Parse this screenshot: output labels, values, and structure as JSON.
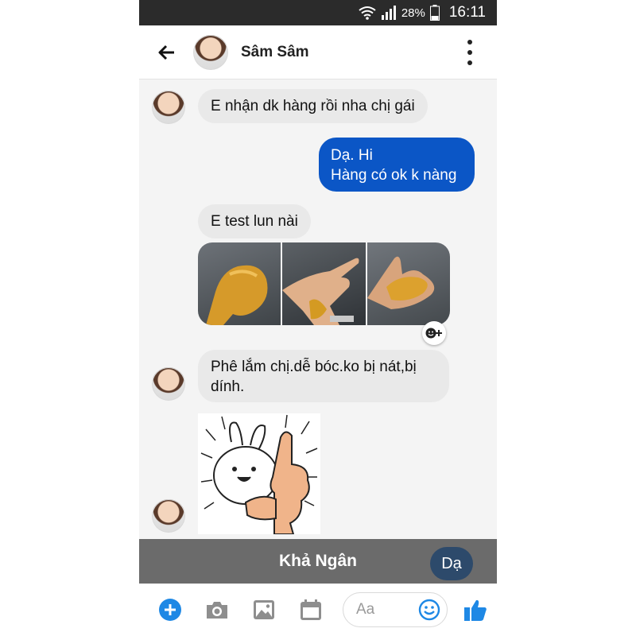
{
  "status_bar": {
    "battery": "28%",
    "time": "16:11",
    "icons": [
      "wifi-icon",
      "signal-icon",
      "battery-icon"
    ]
  },
  "header": {
    "contact_name": "Sâm Sâm",
    "icons": [
      "back-arrow-icon",
      "more-vertical-icon"
    ]
  },
  "messages": [
    {
      "direction": "incoming",
      "text": "E nhận dk hàng rồi nha chị gái"
    },
    {
      "direction": "outgoing",
      "lines": [
        "Dạ. Hi",
        "Hàng có ok k nàng"
      ]
    },
    {
      "direction": "incoming",
      "text": "E test lun nài"
    },
    {
      "direction": "incoming",
      "type": "photos",
      "count": 3
    },
    {
      "direction": "incoming",
      "lines": [
        "Phê lắm chị.dễ bóc.ko bị nát,bị",
        "dính."
      ]
    },
    {
      "direction": "incoming",
      "type": "sticker",
      "sticker": "rabbit-thumbs-up"
    }
  ],
  "banner": {
    "name": "Khả Ngân",
    "quick_reply": "Dạ"
  },
  "composer": {
    "placeholder": "Aa",
    "icons": [
      "plus-icon",
      "camera-icon",
      "gallery-icon",
      "calendar-icon",
      "emoji-icon",
      "thumbs-up-icon"
    ]
  },
  "colors": {
    "accent": "#0b56c6",
    "incoming_bubble": "#e9e9e9",
    "banner": "#6b6b6b",
    "messenger_blue": "#1e88e5"
  }
}
